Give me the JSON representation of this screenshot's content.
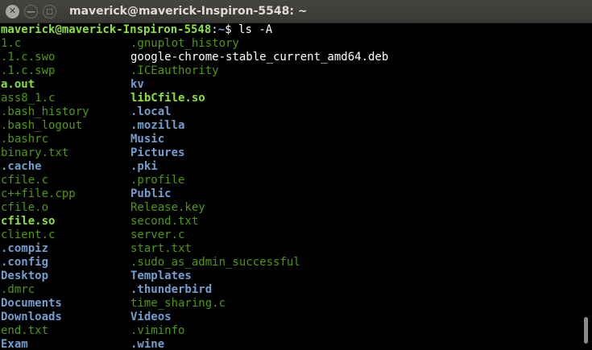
{
  "window": {
    "title": "maverick@maverick-Inspiron-5548: ~",
    "close_glyph": "✕",
    "minimize_glyph": "—",
    "maximize_glyph": "□"
  },
  "prompt": {
    "user_host": "maverick@maverick-Inspiron-5548",
    "separator": ":",
    "path": "~",
    "symbol": "$ ",
    "command": "ls -A"
  },
  "listing": [
    {
      "left": {
        "text": "1.c",
        "type": "file"
      },
      "right": {
        "text": ".gnuplot_history",
        "type": "file"
      }
    },
    {
      "left": {
        "text": ".1.c.swo",
        "type": "file"
      },
      "right": {
        "text": "google-chrome-stable_current_amd64.deb",
        "type": "archive"
      }
    },
    {
      "left": {
        "text": ".1.c.swp",
        "type": "file"
      },
      "right": {
        "text": ".ICEauthority",
        "type": "file"
      }
    },
    {
      "left": {
        "text": "a.out",
        "type": "exec"
      },
      "right": {
        "text": "kv",
        "type": "dir"
      }
    },
    {
      "left": {
        "text": "ass8_1.c",
        "type": "file"
      },
      "right": {
        "text": "libCfile.so",
        "type": "exec"
      }
    },
    {
      "left": {
        "text": ".bash_history",
        "type": "file"
      },
      "right": {
        "text": ".local",
        "type": "dir"
      }
    },
    {
      "left": {
        "text": ".bash_logout",
        "type": "file"
      },
      "right": {
        "text": ".mozilla",
        "type": "dir"
      }
    },
    {
      "left": {
        "text": ".bashrc",
        "type": "file"
      },
      "right": {
        "text": "Music",
        "type": "dir"
      }
    },
    {
      "left": {
        "text": "binary.txt",
        "type": "file"
      },
      "right": {
        "text": "Pictures",
        "type": "dir"
      }
    },
    {
      "left": {
        "text": ".cache",
        "type": "dir"
      },
      "right": {
        "text": ".pki",
        "type": "dir"
      }
    },
    {
      "left": {
        "text": "cfile.c",
        "type": "file"
      },
      "right": {
        "text": ".profile",
        "type": "file"
      }
    },
    {
      "left": {
        "text": "c++file.cpp",
        "type": "file"
      },
      "right": {
        "text": "Public",
        "type": "dir"
      }
    },
    {
      "left": {
        "text": "cfile.o",
        "type": "file"
      },
      "right": {
        "text": "Release.key",
        "type": "file"
      }
    },
    {
      "left": {
        "text": "cfile.so",
        "type": "exec"
      },
      "right": {
        "text": "second.txt",
        "type": "file"
      }
    },
    {
      "left": {
        "text": "client.c",
        "type": "file"
      },
      "right": {
        "text": "server.c",
        "type": "file"
      }
    },
    {
      "left": {
        "text": ".compiz",
        "type": "dir"
      },
      "right": {
        "text": "start.txt",
        "type": "file"
      }
    },
    {
      "left": {
        "text": ".config",
        "type": "dir"
      },
      "right": {
        "text": ".sudo_as_admin_successful",
        "type": "file"
      }
    },
    {
      "left": {
        "text": "Desktop",
        "type": "dir"
      },
      "right": {
        "text": "Templates",
        "type": "dir"
      }
    },
    {
      "left": {
        "text": ".dmrc",
        "type": "file"
      },
      "right": {
        "text": ".thunderbird",
        "type": "dir"
      }
    },
    {
      "left": {
        "text": "Documents",
        "type": "dir"
      },
      "right": {
        "text": "time_sharing.c",
        "type": "file"
      }
    },
    {
      "left": {
        "text": "Downloads",
        "type": "dir"
      },
      "right": {
        "text": "Videos",
        "type": "dir"
      }
    },
    {
      "left": {
        "text": "end.txt",
        "type": "file"
      },
      "right": {
        "text": ".viminfo",
        "type": "file"
      }
    },
    {
      "left": {
        "text": "Exam",
        "type": "dir"
      },
      "right": {
        "text": ".wine",
        "type": "dir"
      }
    }
  ],
  "colors": {
    "background": "#000000",
    "file": "#4e9a06",
    "exec": "#8ae234",
    "dir": "#729fcf",
    "archive": "#ef2929",
    "prompt_user": "#8ae234",
    "prompt_path": "#729fcf"
  },
  "scrollbar": {
    "position_fraction": 0.93
  }
}
